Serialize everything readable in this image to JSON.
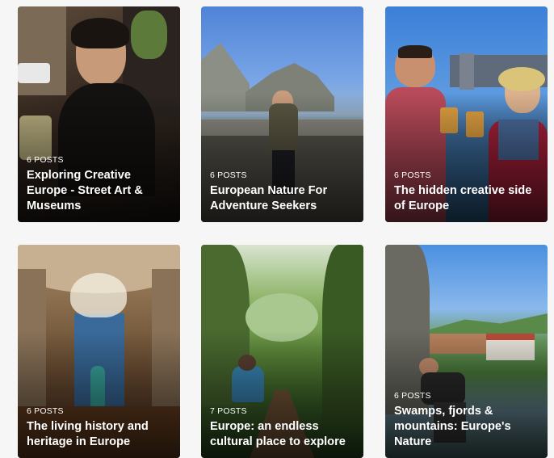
{
  "cards": [
    {
      "count": "6 POSTS",
      "title": "Exploring Creative Europe - Street Art & Museums"
    },
    {
      "count": "6 POSTS",
      "title": "European Nature For Adventure Seekers"
    },
    {
      "count": "6 POSTS",
      "title": "The hidden creative side of Europe"
    },
    {
      "count": "6 POSTS",
      "title": "The living history and heritage in Europe"
    },
    {
      "count": "7 POSTS",
      "title": "Europe: an endless cultural place to explore"
    },
    {
      "count": "6 POSTS",
      "title": "Swamps, fjords & mountains: Europe's Nature"
    }
  ]
}
